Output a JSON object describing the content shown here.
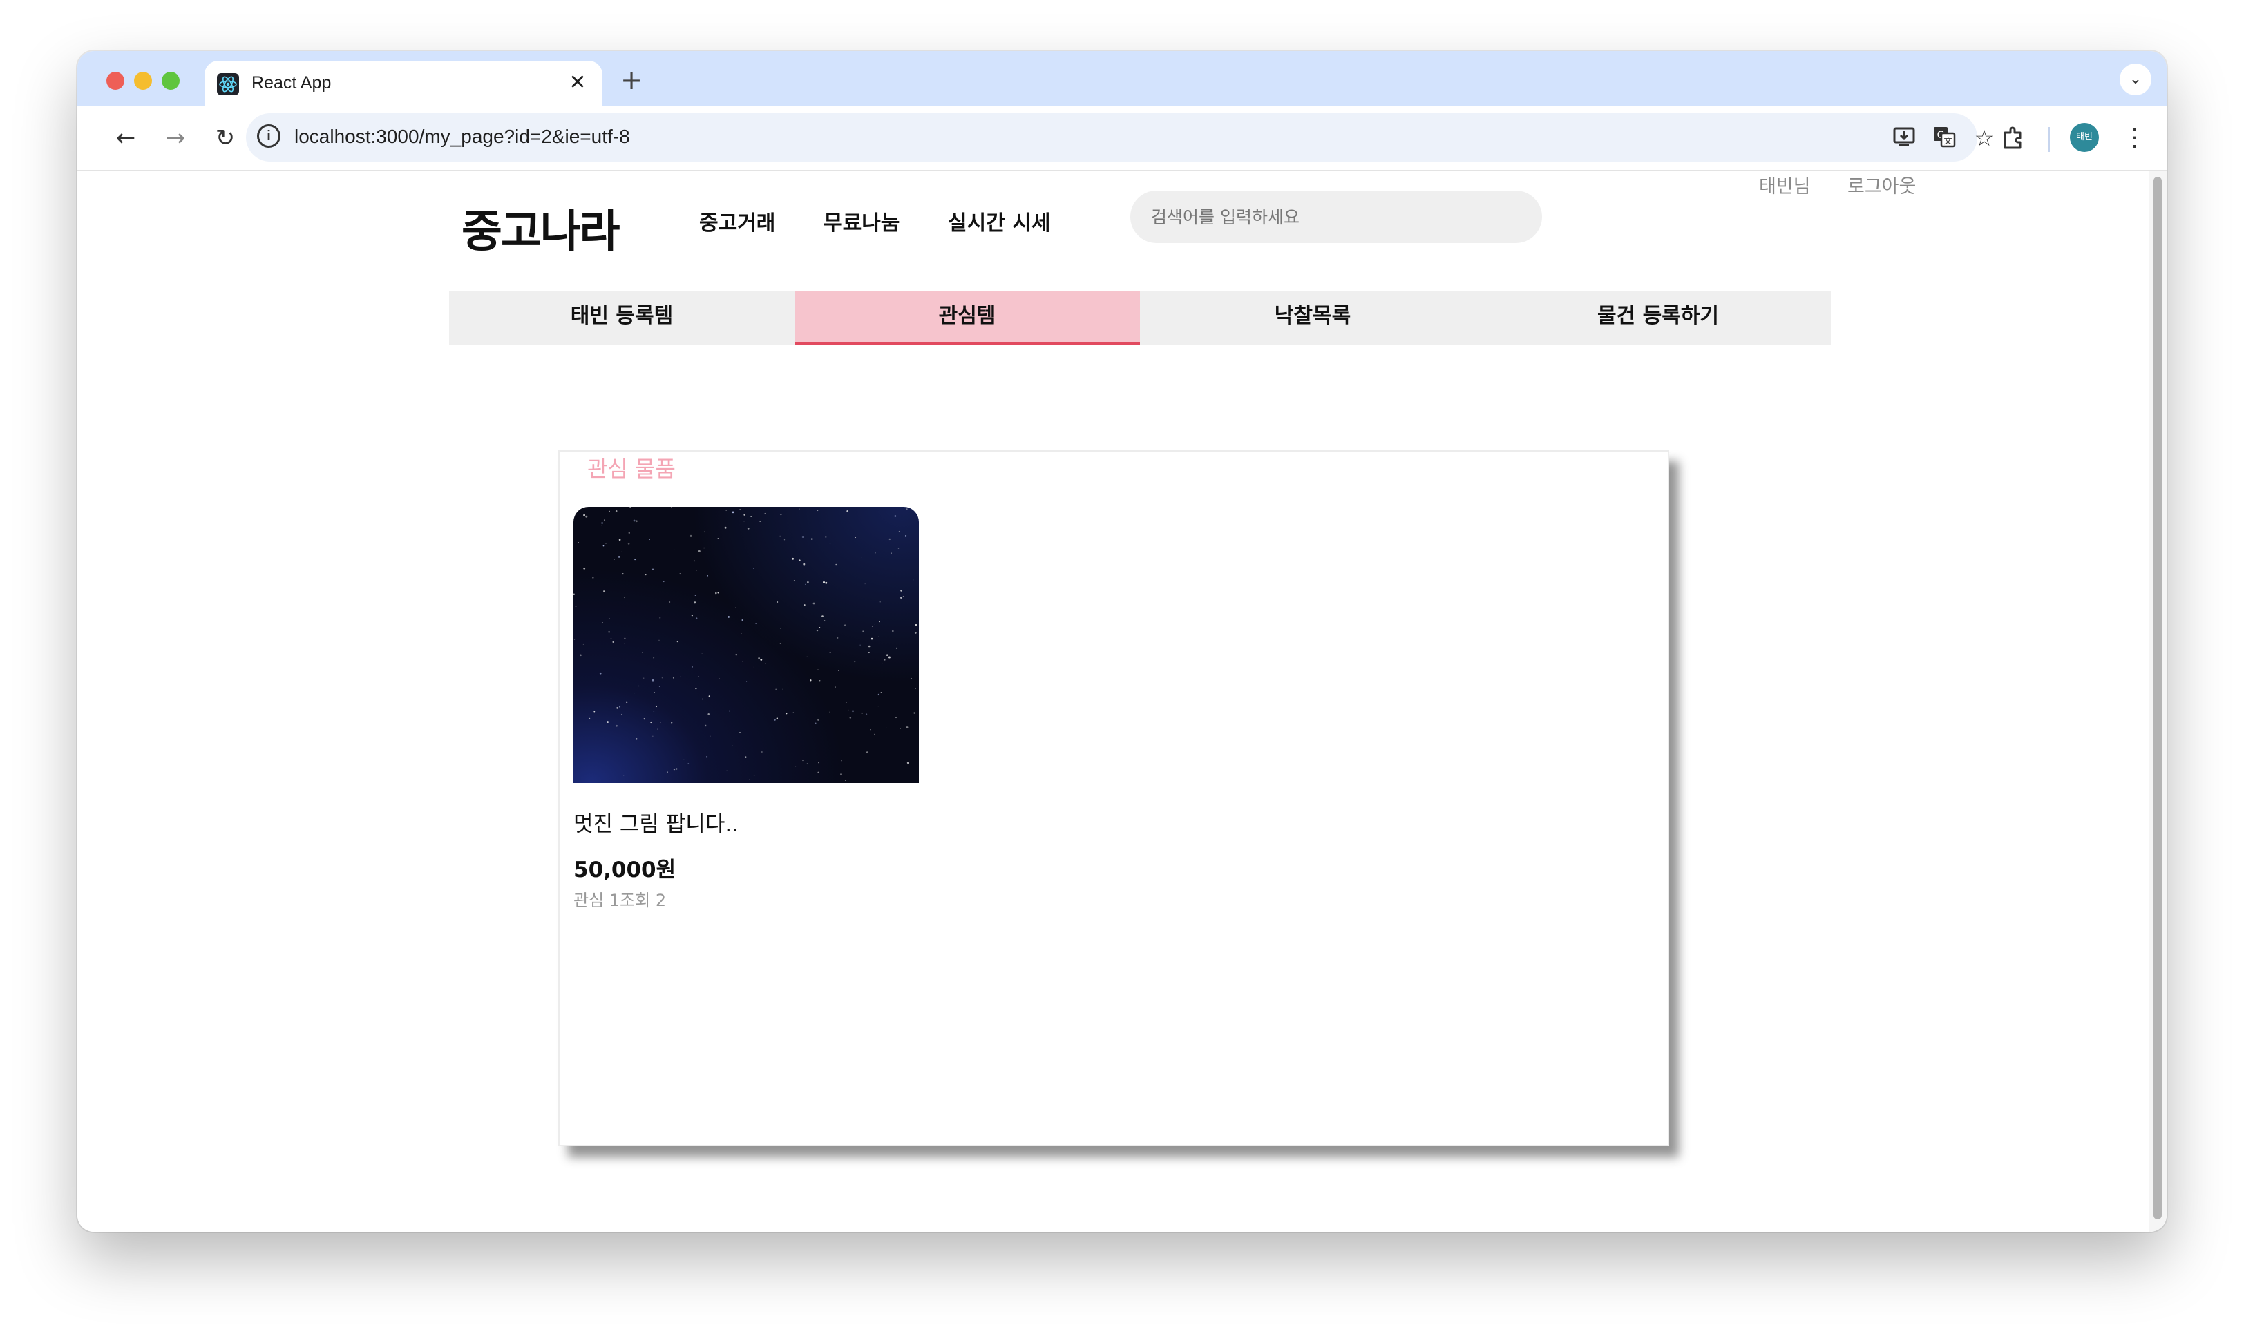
{
  "browser": {
    "tab_title": "React App",
    "tab_close": "✕",
    "new_tab": "+",
    "url": "localhost:3000/my_page?id=2&ie=utf-8",
    "avatar_text": "태빈"
  },
  "header": {
    "logo": "중고나라",
    "nav": [
      "중고거래",
      "무료나눔",
      "실시간 시세"
    ],
    "search_placeholder": "검색어를 입력하세요",
    "user_name": "태빈님",
    "logout_label": "로그아웃"
  },
  "subtabs": [
    "태빈 등록템",
    "관심템",
    "낙찰목록",
    "물건 등록하기"
  ],
  "active_subtab": "관심템",
  "panel": {
    "title": "관심 물품",
    "items": [
      {
        "image": "starry-night-sky-image",
        "title": "멋진 그림 팝니다..",
        "price": "50,000원",
        "meta": "관심 1조회 2"
      }
    ]
  },
  "colors": {
    "active_tab_bg": "#f6c4cd",
    "active_tab_border": "#e24a5f",
    "panel_title": "#f4a5b4",
    "chrome_tabbar": "#d3e3fd"
  }
}
